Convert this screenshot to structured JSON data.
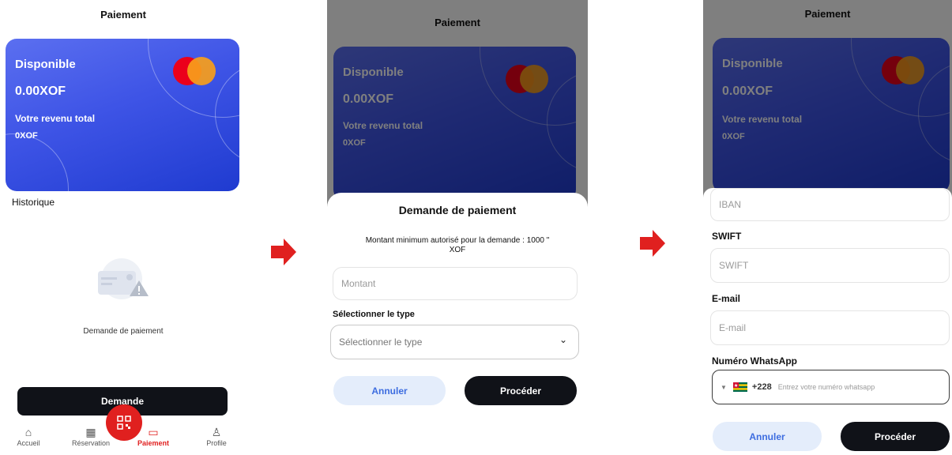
{
  "screen1": {
    "title": "Paiement",
    "card": {
      "available_label": "Disponible",
      "available_value": "0.00XOF",
      "income_label": "Votre revenu total",
      "income_value": "0XOF"
    },
    "history_label": "Historique",
    "empty_text": "Demande de paiement",
    "demande_button": "Demande",
    "nav": [
      {
        "label": "Accueil",
        "icon": "home-icon"
      },
      {
        "label": "Réservation",
        "icon": "calendar-icon"
      },
      {
        "label": "Paiement",
        "icon": "wallet-icon"
      },
      {
        "label": "Profile",
        "icon": "user-icon"
      }
    ]
  },
  "screen2": {
    "title": "Paiement",
    "card": {
      "available_label": "Disponible",
      "available_value": "0.00XOF",
      "income_label": "Votre revenu total",
      "income_value": "0XOF"
    },
    "modal_title": "Demande de paiement",
    "min_text_line1": "Montant minimum autorisé pour la demande : 1000 \"",
    "min_text_line2": "XOF",
    "amount_placeholder": "Montant",
    "type_label": "Sélectionner le type",
    "type_placeholder": "Sélectionner le type",
    "cancel": "Annuler",
    "proceed": "Procéder"
  },
  "screen3": {
    "title": "Paiement",
    "card": {
      "available_label": "Disponible",
      "available_value": "0.00XOF",
      "income_label": "Votre revenu total",
      "income_value": "0XOF"
    },
    "iban_placeholder": "IBAN",
    "swift_label": "SWIFT",
    "swift_placeholder": "SWIFT",
    "email_label": "E-mail",
    "email_placeholder": "E-mail",
    "whatsapp_label": "Numéro WhatsApp",
    "country_code": "+228",
    "whatsapp_placeholder": "Entrez votre numéro whatsapp",
    "cancel": "Annuler",
    "proceed": "Procéder"
  },
  "colors": {
    "accent_red": "#e0201f",
    "card_blue": "#3e54e6",
    "dark_button": "#101218",
    "light_button": "#e4edfb"
  }
}
